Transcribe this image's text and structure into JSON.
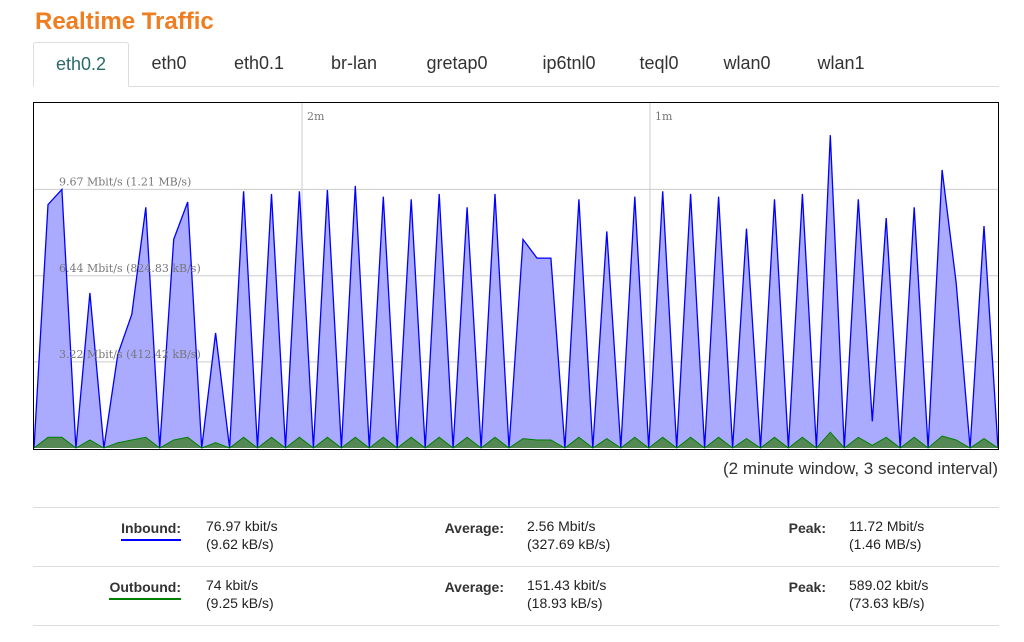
{
  "title": "Realtime Traffic",
  "tabs": [
    {
      "label": "eth0.2",
      "active": true
    },
    {
      "label": "eth0",
      "active": false
    },
    {
      "label": "eth0.1",
      "active": false
    },
    {
      "label": "br-lan",
      "active": false
    },
    {
      "label": "gretap0",
      "active": false
    },
    {
      "label": "ip6tnl0",
      "active": false
    },
    {
      "label": "teql0",
      "active": false
    },
    {
      "label": "wlan0",
      "active": false
    },
    {
      "label": "wlan1",
      "active": false
    }
  ],
  "chart_data": {
    "type": "area",
    "time_markers": [
      {
        "label": "2m"
      },
      {
        "label": "1m"
      }
    ],
    "y_gridlines": [
      {
        "label": "9.67 Mbit/s (1.21 MB/s)",
        "value": 9.67
      },
      {
        "label": "6.44 Mbit/s (824.83 kB/s)",
        "value": 6.44
      },
      {
        "label": "3.22 Mbit/s (412.42 kB/s)",
        "value": 3.22
      }
    ],
    "y_unit": "Mbit/s",
    "ylim": [
      0,
      12.9
    ],
    "series": [
      {
        "name": "Inbound",
        "color": "#0000ff",
        "fill": "#aaaaff",
        "values": [
          0,
          9.1,
          9.67,
          0,
          5.8,
          0,
          3.5,
          5.0,
          9.0,
          0,
          7.8,
          9.2,
          0,
          4.3,
          0,
          9.6,
          0,
          9.5,
          0,
          9.6,
          0,
          9.65,
          0,
          9.8,
          0,
          9.4,
          0,
          9.3,
          0,
          9.5,
          0,
          9.0,
          0,
          9.5,
          0,
          7.8,
          7.1,
          7.1,
          0,
          9.3,
          0,
          8.1,
          0,
          9.4,
          0,
          9.6,
          0,
          9.5,
          0,
          9.4,
          0,
          8.2,
          0,
          9.3,
          0,
          9.5,
          0,
          11.7,
          0,
          9.3,
          1.0,
          8.6,
          0,
          9.0,
          0,
          10.4,
          6.2,
          0,
          8.3,
          0
        ]
      },
      {
        "name": "Outbound",
        "color": "#008000",
        "fill": "#558855",
        "values": [
          0,
          0.4,
          0.4,
          0,
          0.3,
          0,
          0.2,
          0.3,
          0.4,
          0,
          0.3,
          0.4,
          0,
          0.2,
          0,
          0.4,
          0,
          0.4,
          0,
          0.4,
          0,
          0.4,
          0,
          0.4,
          0,
          0.4,
          0,
          0.4,
          0,
          0.4,
          0,
          0.4,
          0,
          0.4,
          0,
          0.35,
          0.3,
          0.3,
          0,
          0.4,
          0,
          0.35,
          0,
          0.4,
          0,
          0.4,
          0,
          0.4,
          0,
          0.4,
          0,
          0.35,
          0,
          0.4,
          0,
          0.4,
          0,
          0.59,
          0,
          0.4,
          0.1,
          0.4,
          0,
          0.4,
          0,
          0.45,
          0.3,
          0,
          0.35,
          0
        ]
      }
    ]
  },
  "window_note": "(2 minute window, 3 second interval)",
  "stats": {
    "inbound": {
      "label": "Inbound:",
      "current": "76.97 kbit/s",
      "current_bytes": "(9.62 kB/s)",
      "avg_label": "Average:",
      "average": "2.56 Mbit/s",
      "average_bytes": "(327.69 kB/s)",
      "peak_label": "Peak:",
      "peak": "11.72 Mbit/s",
      "peak_bytes": "(1.46 MB/s)"
    },
    "outbound": {
      "label": "Outbound:",
      "current": "74 kbit/s",
      "current_bytes": "(9.25 kB/s)",
      "avg_label": "Average:",
      "average": "151.43 kbit/s",
      "average_bytes": "(18.93 kB/s)",
      "peak_label": "Peak:",
      "peak": "589.02 kbit/s",
      "peak_bytes": "(73.63 kB/s)"
    }
  }
}
